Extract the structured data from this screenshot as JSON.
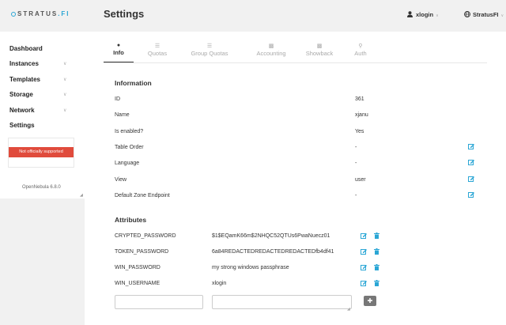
{
  "brand": {
    "name_main": "STRATUS",
    "name_accent": ".FI",
    "accent_color": "#2aa6d5"
  },
  "sidebar": {
    "items": [
      {
        "label": "Dashboard",
        "has_chevron": false
      },
      {
        "label": "Instances",
        "has_chevron": true
      },
      {
        "label": "Templates",
        "has_chevron": true
      },
      {
        "label": "Storage",
        "has_chevron": true
      },
      {
        "label": "Network",
        "has_chevron": true
      },
      {
        "label": "Settings",
        "has_chevron": false
      }
    ],
    "support_badge": "Not officially supported",
    "version": "OpenNebula 6.8.0"
  },
  "header": {
    "title": "Settings",
    "user": "xlogin",
    "zone": "StratusFI"
  },
  "tabs": [
    {
      "label": "Info",
      "icon": "info-icon",
      "active": true
    },
    {
      "label": "Quotas",
      "icon": "list-icon",
      "active": false
    },
    {
      "label": "Group Quotas",
      "icon": "list-icon",
      "active": false
    },
    {
      "label": "Accounting",
      "icon": "bar-chart-icon",
      "active": false
    },
    {
      "label": "Showback",
      "icon": "money-icon",
      "active": false
    },
    {
      "label": "Auth",
      "icon": "key-icon",
      "active": false
    }
  ],
  "information": {
    "title": "Information",
    "rows": [
      {
        "label": "ID",
        "value": "361",
        "editable": false
      },
      {
        "label": "Name",
        "value": "xjanu",
        "editable": false
      },
      {
        "label": "Is enabled?",
        "value": "Yes",
        "editable": false
      },
      {
        "label": "Table Order",
        "value": "-",
        "editable": true
      },
      {
        "label": "Language",
        "value": "-",
        "editable": true
      },
      {
        "label": "View",
        "value": "user",
        "editable": true
      },
      {
        "label": "Default Zone Endpoint",
        "value": "-",
        "editable": true
      }
    ]
  },
  "attributes": {
    "title": "Attributes",
    "rows": [
      {
        "key": "CRYPTED_PASSWORD",
        "value": "$1$EQamK66m$2NHQC52QTUs6PwaNuecz01"
      },
      {
        "key": "TOKEN_PASSWORD",
        "value": "6a84REDACTEDREDACTEDREDACTEDfb4df41"
      },
      {
        "key": "WIN_PASSWORD",
        "value": "my strong windows passphrase"
      },
      {
        "key": "WIN_USERNAME",
        "value": "xlogin"
      }
    ],
    "new_key_value": "",
    "new_value_value": ""
  },
  "colors": {
    "edit": "#2aa6d5",
    "badge": "#e04b3c"
  }
}
